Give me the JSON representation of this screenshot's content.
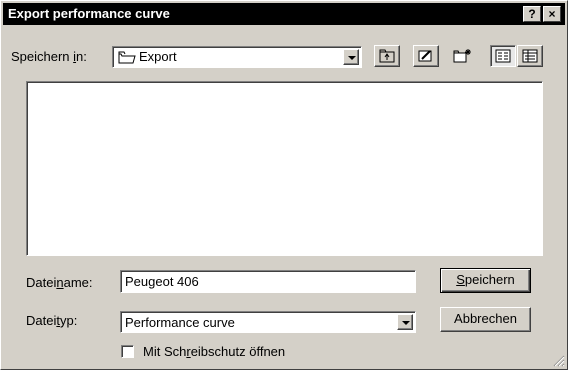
{
  "window": {
    "title": "Export performance curve",
    "help_label": "?",
    "close_label": "×"
  },
  "save_in": {
    "label_before": "Speichern ",
    "label_mnemonic": "i",
    "label_after": "n:",
    "selected": "Export"
  },
  "toolbar": {
    "icons": [
      "up-folder-icon",
      "desktop-icon",
      "new-folder-icon",
      "list-view-icon",
      "details-view-icon"
    ]
  },
  "file_name": {
    "label_before": "Datei",
    "label_mnemonic": "n",
    "label_after": "ame:",
    "value": "Peugeot 406"
  },
  "file_type": {
    "label_before": "Datei",
    "label_mnemonic": "t",
    "label_after": "yp:",
    "selected": "Performance curve"
  },
  "buttons": {
    "save_mnemonic": "S",
    "save_rest": "peichern",
    "cancel": "Abbrechen"
  },
  "readonly_checkbox": {
    "label_before": "Mit Sch",
    "label_mnemonic": "r",
    "label_after": "eibschutz öffnen",
    "checked": false
  }
}
